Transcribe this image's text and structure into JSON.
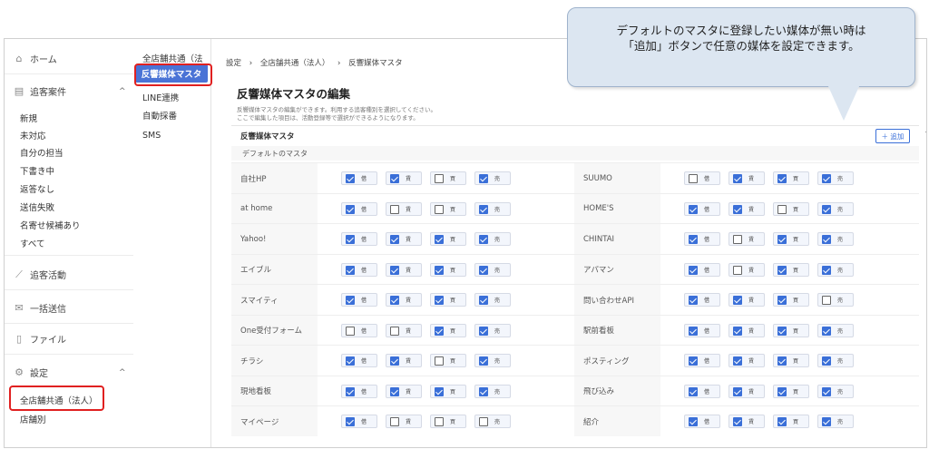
{
  "sidebar": {
    "home": "ホーム",
    "tsuikyaku_anken": "追客案件",
    "anken_items": [
      "新規",
      "未対応",
      "自分の担当",
      "下書き中",
      "返答なし",
      "送信失敗",
      "名寄せ候補あり",
      "すべて"
    ],
    "tsuikyaku_katsudo": "追客活動",
    "ikkatsu_soushin": "一括送信",
    "file": "ファイル",
    "settings": "設定",
    "settings_items": [
      "全店舗共通（法人）",
      "店舗別"
    ]
  },
  "col2": {
    "items": [
      "全店舗共通（法人）",
      "反響媒体マスタ",
      "LINE連携",
      "自動採番",
      "SMS"
    ]
  },
  "breadcrumb": [
    "設定",
    "›",
    "全店舗共通（法人）",
    "›",
    "反響媒体マスタ"
  ],
  "main": {
    "title": "反響媒体マスタの編集",
    "desc1": "反響媒体マスタの編集ができます。利用する追客種別を選択してください。",
    "desc2": "ここで編集した項目は、活動登録等で選択ができるようになります。",
    "panel_label": "反響媒体マスタ",
    "add_button": "＋ 追加",
    "collapse": "^",
    "default_label": "デフォルトのマスタ"
  },
  "checkbox_labels": [
    "借",
    "賃",
    "買",
    "売"
  ],
  "left_rows": [
    {
      "name": "自社HP",
      "checks": [
        true,
        true,
        false,
        true
      ]
    },
    {
      "name": "at home",
      "checks": [
        true,
        false,
        false,
        true
      ]
    },
    {
      "name": "Yahoo!",
      "checks": [
        true,
        true,
        true,
        true
      ]
    },
    {
      "name": "エイブル",
      "checks": [
        true,
        true,
        true,
        true
      ]
    },
    {
      "name": "スマイティ",
      "checks": [
        true,
        true,
        true,
        true
      ]
    },
    {
      "name": "One受付フォーム",
      "checks": [
        false,
        false,
        true,
        true
      ]
    },
    {
      "name": "チラシ",
      "checks": [
        true,
        true,
        false,
        true
      ]
    },
    {
      "name": "現地看板",
      "checks": [
        true,
        true,
        true,
        true
      ]
    },
    {
      "name": "マイページ",
      "checks": [
        true,
        false,
        false,
        false
      ]
    }
  ],
  "right_rows": [
    {
      "name": "SUUMO",
      "checks": [
        false,
        true,
        true,
        true
      ]
    },
    {
      "name": "HOME'S",
      "checks": [
        true,
        true,
        false,
        true
      ]
    },
    {
      "name": "CHINTAI",
      "checks": [
        true,
        false,
        true,
        true
      ]
    },
    {
      "name": "アパマン",
      "checks": [
        true,
        false,
        true,
        true
      ]
    },
    {
      "name": "問い合わせAPI",
      "checks": [
        true,
        true,
        true,
        false
      ]
    },
    {
      "name": "駅前看板",
      "checks": [
        true,
        true,
        true,
        true
      ]
    },
    {
      "name": "ポスティング",
      "checks": [
        true,
        true,
        true,
        true
      ]
    },
    {
      "name": "飛び込み",
      "checks": [
        true,
        true,
        true,
        true
      ]
    },
    {
      "name": "紹介",
      "checks": [
        true,
        true,
        true,
        true
      ]
    }
  ],
  "callout": {
    "line1": "デフォルトのマスタに登録したい媒体が無い時は",
    "line2": "「追加」ボタンで任意の媒体を設定できます。"
  }
}
